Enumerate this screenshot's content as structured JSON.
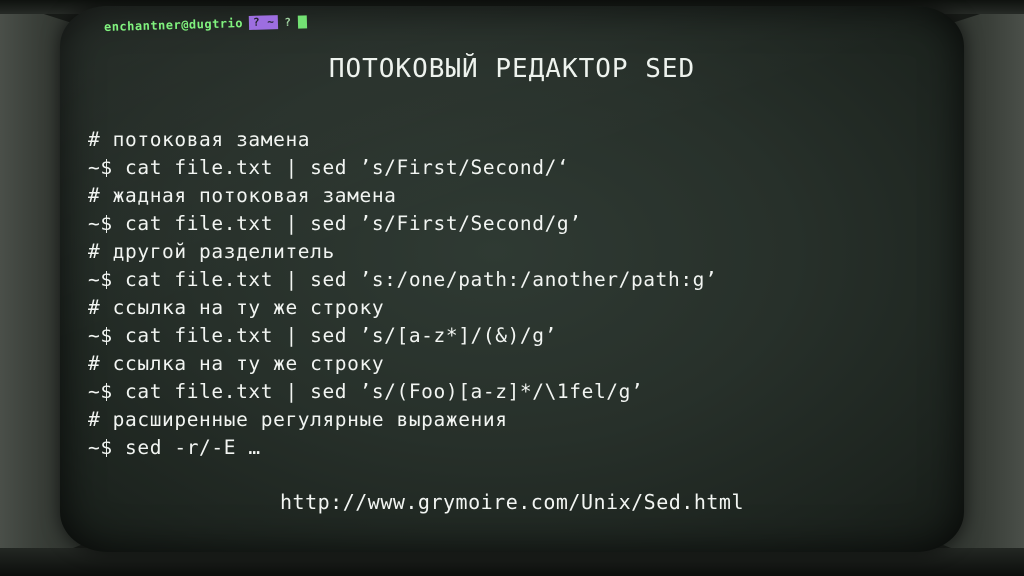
{
  "terminal": {
    "prompt_user": "enchantner@dugtrio",
    "prompt_q1": "?",
    "prompt_path": "~",
    "prompt_q2": "?"
  },
  "slide": {
    "title": "ПОТОКОВЫЙ РЕДАКТОР SED",
    "lines": [
      "# потоковая замена",
      "~$ cat file.txt | sed ’s/First/Second/‘",
      "# жадная потоковая замена",
      "~$ cat file.txt | sed ’s/First/Second/g’",
      "# другой разделитель",
      "~$ cat file.txt | sed ’s:/one/path:/another/path:g’",
      "# ссылка на ту же строку",
      "~$ cat file.txt | sed ’s/[a-z*]/(&)/g’",
      "# ссылка на ту же строку",
      "~$ cat file.txt | sed ’s/(Foo)[a-z]*/\\1fel/g’",
      "# расширенные регулярные выражения",
      "~$ sed -r/-E …"
    ],
    "url": "http://www.grymoire.com/Unix/Sed.html"
  },
  "colors": {
    "screen": "#27302a",
    "text": "#f2f5f2",
    "prompt_green": "#7cf27a",
    "prompt_purple": "#9a6adf"
  }
}
